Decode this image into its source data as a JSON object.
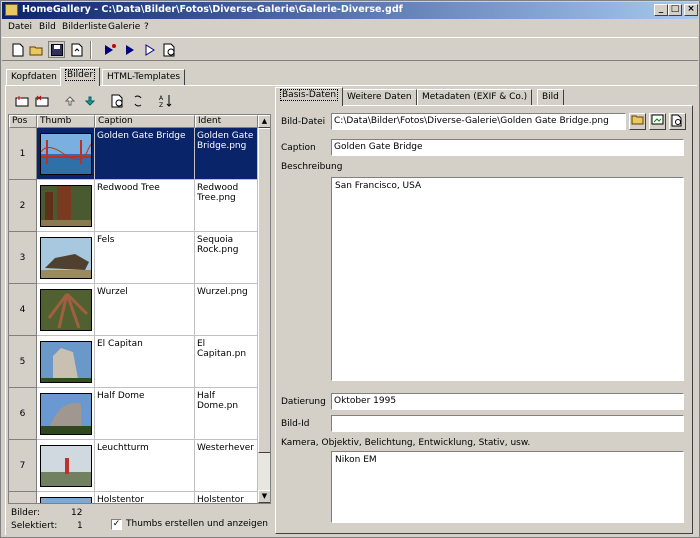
{
  "window": {
    "title": "HomeGallery - C:\\Data\\Bilder\\Fotos\\Diverse-Galerie\\Galerie-Diverse.gdf",
    "minimize": "_",
    "maximize": "□",
    "close": "×"
  },
  "menu": [
    "Datei",
    "Bild",
    "Bilderliste",
    "Galerie",
    "?"
  ],
  "toolbar_icons": [
    "new-file-icon",
    "open-folder-icon",
    "save-disk-icon",
    "export-icon",
    "play-all-icon",
    "play-icon",
    "next-icon",
    "preview-icon"
  ],
  "main_tabs": [
    "Kopfdaten",
    "Bilder",
    "HTML-Templates"
  ],
  "list": {
    "columns": [
      "Pos",
      "Thumb",
      "Caption",
      "Ident"
    ],
    "rows": [
      {
        "pos": "1",
        "caption": "Golden Gate Bridge",
        "ident": "Golden Gate Bridge.png",
        "thumb": "golden-gate-thumb"
      },
      {
        "pos": "2",
        "caption": "Redwood Tree",
        "ident": "Redwood Tree.png",
        "thumb": "redwood-thumb"
      },
      {
        "pos": "3",
        "caption": "Fels",
        "ident": "Sequoia Rock.png",
        "thumb": "rock-thumb"
      },
      {
        "pos": "4",
        "caption": "Wurzel",
        "ident": "Wurzel.png",
        "thumb": "root-thumb"
      },
      {
        "pos": "5",
        "caption": "El Capitan",
        "ident": "El Capitan.pn",
        "thumb": "el-capitan-thumb"
      },
      {
        "pos": "6",
        "caption": "Half Dome",
        "ident": "Half Dome.pn",
        "thumb": "half-dome-thumb"
      },
      {
        "pos": "7",
        "caption": "Leuchtturm",
        "ident": "Westerhever",
        "thumb": "lighthouse-thumb"
      },
      {
        "pos": "8",
        "caption": "Holstentor",
        "ident": "Holstentor",
        "thumb": "holstentor-thumb"
      }
    ]
  },
  "status": {
    "bilder_label": "Bilder:",
    "bilder_value": "12",
    "selektiert_label": "Selektiert:",
    "selektiert_value": "1",
    "thumbs_checkbox_label": "Thumbs erstellen und anzeigen",
    "thumbs_checked": "✓"
  },
  "detail_tabs": [
    "Basis-Daten",
    "Weitere Daten",
    "Metadaten (EXIF & Co.)",
    "Bild"
  ],
  "detail": {
    "bild_datei_label": "Bild-Datei",
    "bild_datei_value": "C:\\Data\\Bilder\\Fotos\\Diverse-Galerie\\Golden Gate Bridge.png",
    "caption_label": "Caption",
    "caption_value": "Golden Gate Bridge",
    "beschreibung_label": "Beschreibung",
    "beschreibung_value": "San Francisco, USA",
    "datierung_label": "Datierung",
    "datierung_value": "Oktober 1995",
    "bild_id_label": "Bild-Id",
    "bild_id_value": "",
    "kamera_label": "Kamera, Objektiv, Belichtung, Entwicklung, Stativ, usw.",
    "kamera_value": "Nikon EM"
  }
}
